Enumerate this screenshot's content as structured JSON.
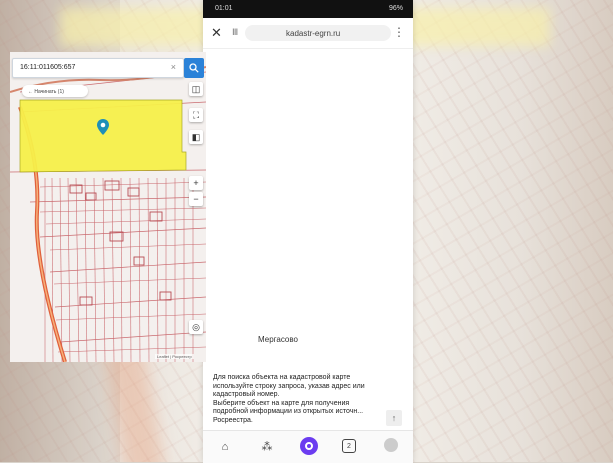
{
  "status_bar": {
    "time": "01:01",
    "system": "96%"
  },
  "browser": {
    "close_icon": "close-icon",
    "reader_icon": "reader-icon",
    "url": "kadastr-egrn.ru",
    "menu_icon": "more-icon"
  },
  "map": {
    "search_value": "16:11:011605:657",
    "search_clear_icon": "clear-icon",
    "history_label": "← Начинать (1)",
    "controls": [
      "layers-icon",
      "fullscreen-icon",
      "basemap-icon",
      "zoom-in",
      "zoom-out",
      "locate-icon"
    ],
    "zoom_in": "+",
    "zoom_out": "−",
    "place_label": "Мергасово",
    "attribution": "Leaflet | Росреестр",
    "highlight_color": "#f7f04a"
  },
  "info": {
    "lines": [
      "Для поиска объекта на кадастровой карте",
      "используйте строку запроса, указав адрес или",
      "кадастровый номер.",
      "Выберите объект на карте для получения",
      "подробной информации из открытых источн...",
      "Росреестра."
    ],
    "scroll_up": "↑"
  },
  "nav": {
    "home": "home-icon",
    "services": "services-icon",
    "alice": "alice-icon",
    "tabs_count": "2",
    "profile": "profile-icon"
  }
}
